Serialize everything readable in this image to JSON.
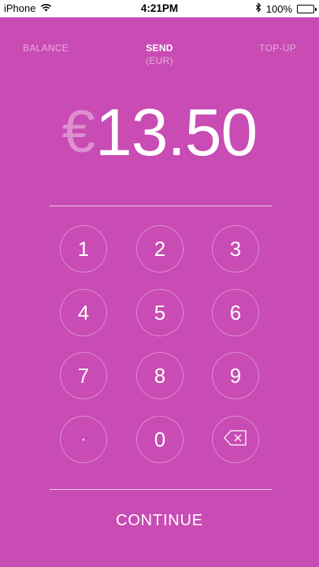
{
  "status_bar": {
    "carrier": "iPhone",
    "time": "4:21PM",
    "battery": "100%",
    "icons": [
      "wifi-icon",
      "bluetooth-icon",
      "battery-icon"
    ]
  },
  "tabs": {
    "balance": "BALANCE",
    "send": "SEND",
    "send_currency": "(EUR)",
    "topup": "TOP-UP"
  },
  "amount": {
    "currency_symbol": "€",
    "value": "13.50"
  },
  "keypad": {
    "k1": "1",
    "k2": "2",
    "k3": "3",
    "k4": "4",
    "k5": "5",
    "k6": "6",
    "k7": "7",
    "k8": "8",
    "k9": "9",
    "kdot": "·",
    "k0": "0",
    "backspace_icon": "backspace-icon"
  },
  "continue_label": "CONTINUE",
  "colors": {
    "background": "#c94bb4",
    "text": "#ffffff"
  }
}
